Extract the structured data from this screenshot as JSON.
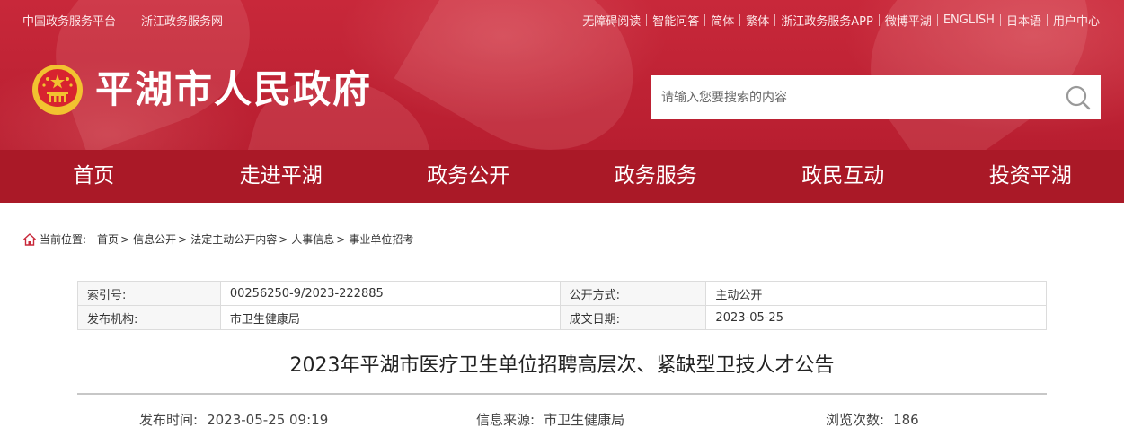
{
  "topbar": {
    "left_links": [
      "中国政务服务平台",
      "浙江政务服务网"
    ],
    "right_links": [
      "无障碍阅读",
      "智能问答",
      "简体",
      "繁体",
      "浙江政务服务APP",
      "微博平湖",
      "ENGLISH",
      "日本语",
      "用户中心"
    ]
  },
  "header": {
    "site_title": "平湖市人民政府",
    "search_placeholder": "请输入您要搜索的内容"
  },
  "nav": {
    "items": [
      "首页",
      "走进平湖",
      "政务公开",
      "政务服务",
      "政民互动",
      "投资平湖"
    ]
  },
  "breadcrumb": {
    "label": "当前位置:",
    "items": [
      "首页",
      "信息公开",
      "法定主动公开内容",
      "人事信息",
      "事业单位招考"
    ]
  },
  "info": {
    "index_label": "索引号:",
    "index_value": "00256250-9/2023-222885",
    "method_label": "公开方式:",
    "method_value": "主动公开",
    "org_label": "发布机构:",
    "org_value": "市卫生健康局",
    "date_label": "成文日期:",
    "date_value": "2023-05-25"
  },
  "article": {
    "title": "2023年平湖市医疗卫生单位招聘高层次、紧缺型卫技人才公告",
    "publish_label": "发布时间:",
    "publish_value": "2023-05-25 09:19",
    "source_label": "信息来源:",
    "source_value": "市卫生健康局",
    "views_label": "浏览次数:",
    "views_value": "186"
  },
  "colors": {
    "header_red": "#c8283a",
    "nav_red": "#aa1927",
    "emblem_gold": "#f2c230"
  }
}
